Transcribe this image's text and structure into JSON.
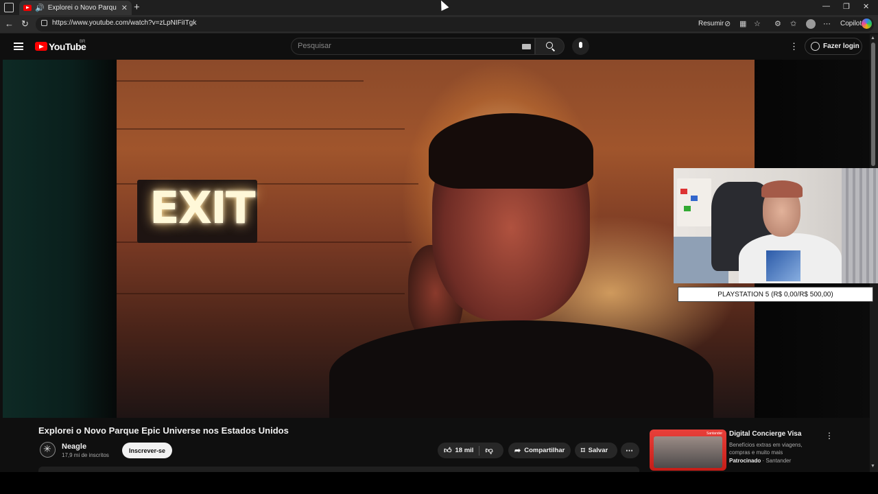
{
  "browser": {
    "tab_title": "Explorei o Novo Parque Epic",
    "url": "https://www.youtube.com/watch?v=zLpNIFiITgk",
    "resumir_label": "Resumir",
    "copilot_label": "Copilot"
  },
  "masthead": {
    "logo_text": "YouTube",
    "region": "BR",
    "search_placeholder": "Pesquisar",
    "login_label": "Fazer login"
  },
  "player": {
    "scene_sign_text": "EXIT",
    "overlay_banner": "PLAYSTATION 5 (R$ 0,00/R$ 500,00)"
  },
  "video": {
    "title": "Explorei o Novo Parque Epic Universe nos Estados Unidos",
    "channel_name": "Neagle",
    "subscribers": "17,9 mi de inscritos",
    "subscribe_label": "Inscrever-se",
    "likes": "18 mil",
    "share_label": "Compartilhar",
    "save_label": "Salvar"
  },
  "ad": {
    "title": "Digital Concierge Visa",
    "description": "Benefícios extras em viagens, compras e muito mais",
    "sponsored_label": "Patrocinado",
    "advertiser": "Santander",
    "thumb_brand": "Santander"
  },
  "colors": {
    "youtube_red": "#ff0000",
    "background": "#0f0f0f",
    "pill_bg": "#272727"
  }
}
